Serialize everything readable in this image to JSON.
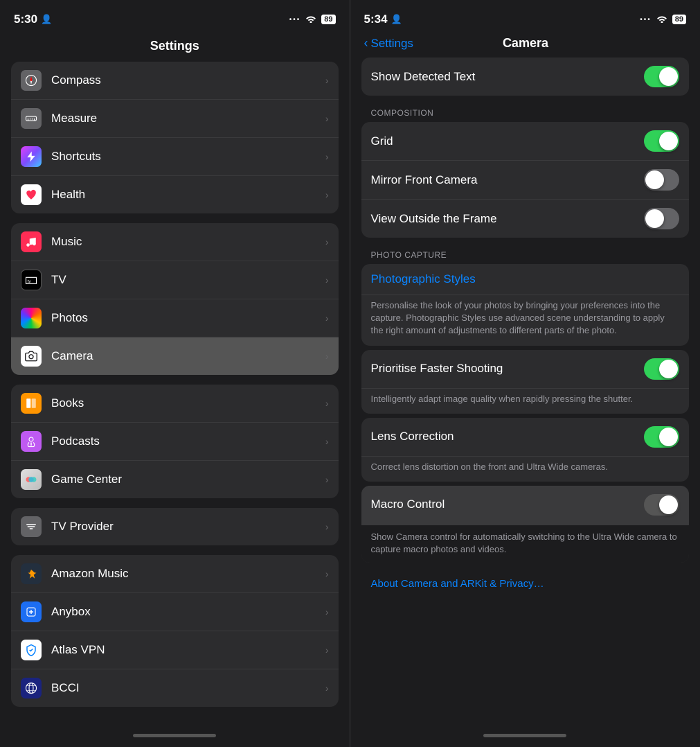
{
  "left": {
    "statusBar": {
      "time": "5:30",
      "personIcon": "👤",
      "dots": "•••",
      "wifi": "wifi",
      "battery": "89"
    },
    "title": "Settings",
    "groups": [
      {
        "id": "group1",
        "items": [
          {
            "id": "compass",
            "label": "Compass",
            "iconBg": "ic-compass",
            "iconChar": "🧭"
          },
          {
            "id": "measure",
            "label": "Measure",
            "iconBg": "ic-measure",
            "iconChar": "📏"
          },
          {
            "id": "shortcuts",
            "label": "Shortcuts",
            "iconBg": "ic-shortcuts",
            "iconChar": "⚡"
          },
          {
            "id": "health",
            "label": "Health",
            "iconBg": "ic-health",
            "iconChar": "❤️"
          }
        ]
      },
      {
        "id": "group2",
        "items": [
          {
            "id": "music",
            "label": "Music",
            "iconBg": "ic-music",
            "iconChar": "♪"
          },
          {
            "id": "tv",
            "label": "TV",
            "iconBg": "ic-tv",
            "iconChar": "tv"
          },
          {
            "id": "photos",
            "label": "Photos",
            "iconBg": "ic-photos",
            "iconChar": "🌸"
          },
          {
            "id": "camera",
            "label": "Camera",
            "iconBg": "ic-camera",
            "iconChar": "📷",
            "active": true
          }
        ]
      },
      {
        "id": "group3",
        "items": [
          {
            "id": "books",
            "label": "Books",
            "iconBg": "ic-books",
            "iconChar": "📚"
          },
          {
            "id": "podcasts",
            "label": "Podcasts",
            "iconBg": "ic-podcasts",
            "iconChar": "🎙"
          },
          {
            "id": "gamecenter",
            "label": "Game Center",
            "iconBg": "ic-gamecenter",
            "iconChar": "🎮"
          }
        ]
      },
      {
        "id": "group4",
        "items": [
          {
            "id": "tvprovider",
            "label": "TV Provider",
            "iconBg": "ic-tvprovider",
            "iconChar": "S"
          }
        ]
      },
      {
        "id": "group5",
        "items": [
          {
            "id": "amazonmusic",
            "label": "Amazon Music",
            "iconBg": "ic-amazonmusic",
            "iconChar": "♪"
          },
          {
            "id": "anybox",
            "label": "Anybox",
            "iconBg": "ic-anybox",
            "iconChar": "A"
          },
          {
            "id": "atlasvpn",
            "label": "Atlas VPN",
            "iconBg": "ic-atlasvpn",
            "iconChar": "🛡"
          },
          {
            "id": "bcci",
            "label": "BCCI",
            "iconBg": "ic-bcci",
            "iconChar": "🏏"
          }
        ]
      }
    ]
  },
  "right": {
    "statusBar": {
      "time": "5:34",
      "personIcon": "👤",
      "dots": "•••",
      "wifi": "wifi",
      "battery": "89"
    },
    "backLabel": "Settings",
    "title": "Camera",
    "sections": [
      {
        "id": "sec-top",
        "rows": [
          {
            "id": "show-detected-text",
            "label": "Show Detected Text",
            "toggleState": "on"
          }
        ]
      },
      {
        "id": "sec-composition",
        "sectionLabel": "COMPOSITION",
        "rows": [
          {
            "id": "grid",
            "label": "Grid",
            "toggleState": "on"
          },
          {
            "id": "mirror-front",
            "label": "Mirror Front Camera",
            "toggleState": "off"
          },
          {
            "id": "view-outside",
            "label": "View Outside the Frame",
            "toggleState": "off"
          }
        ]
      },
      {
        "id": "sec-photo-capture",
        "sectionLabel": "PHOTO CAPTURE",
        "photoStyles": {
          "linkLabel": "Photographic Styles",
          "desc": "Personalise the look of your photos by bringing your preferences into the capture. Photographic Styles use advanced scene understanding to apply the right amount of adjustments to different parts of the photo."
        },
        "rows": [
          {
            "id": "prioritise-faster-shooting",
            "label": "Prioritise Faster Shooting",
            "toggleState": "on",
            "desc": "Intelligently adapt image quality when rapidly pressing the shutter."
          },
          {
            "id": "lens-correction",
            "label": "Lens Correction",
            "toggleState": "on",
            "desc": "Correct lens distortion on the front and Ultra Wide cameras."
          },
          {
            "id": "macro-control",
            "label": "Macro Control",
            "toggleState": "off",
            "highlighted": true,
            "desc": "Show Camera control for automatically switching to the Ultra Wide camera to capture macro photos and videos."
          }
        ]
      }
    ],
    "aboutLink": "About Camera and ARKit & Privacy…"
  }
}
